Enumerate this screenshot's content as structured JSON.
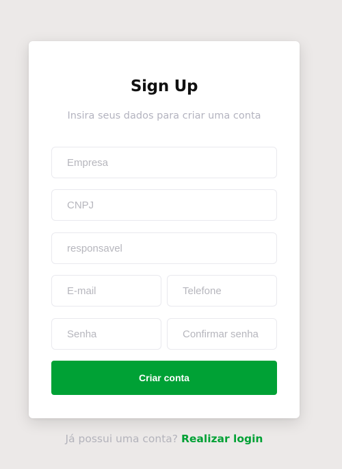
{
  "form": {
    "title": "Sign Up",
    "subtitle": "Insira seus dados para criar uma conta",
    "fields": {
      "company": {
        "placeholder": "Empresa",
        "value": ""
      },
      "cnpj": {
        "placeholder": "CNPJ",
        "value": ""
      },
      "responsible": {
        "placeholder": "responsavel",
        "value": ""
      },
      "email": {
        "placeholder": "E-mail",
        "value": ""
      },
      "phone": {
        "placeholder": "Telefone",
        "value": ""
      },
      "password": {
        "placeholder": "Senha",
        "value": ""
      },
      "confirm_password": {
        "placeholder": "Confirmar senha",
        "value": ""
      }
    },
    "submit_label": "Criar conta"
  },
  "footer": {
    "prompt": "Já possui uma conta?",
    "login_link": "Realizar login"
  },
  "colors": {
    "background": "#ece9e8",
    "accent": "#00a135",
    "muted_text": "#b3b3bf"
  }
}
